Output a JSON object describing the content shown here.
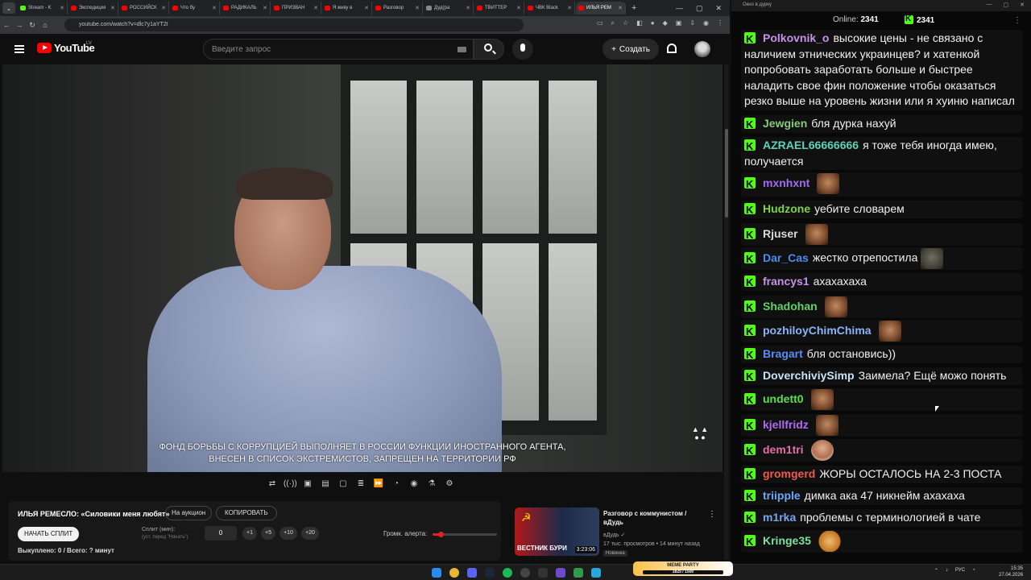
{
  "browser": {
    "tabs": [
      {
        "label": "Stream - K",
        "fav": "g"
      },
      {
        "label": "Экспедиция",
        "fav": "r"
      },
      {
        "label": "РОССИЙСК",
        "fav": "r"
      },
      {
        "label": "Что бу",
        "fav": "r"
      },
      {
        "label": "РАДИКАЛЬ",
        "fav": "r"
      },
      {
        "label": "ПРИЗВАН",
        "fav": "r"
      },
      {
        "label": "Я живу в",
        "fav": "r"
      },
      {
        "label": "Разговор",
        "fav": "r"
      },
      {
        "label": "Дуд(ра",
        "fav": "w"
      },
      {
        "label": "ТВИТТЕР",
        "fav": "r"
      },
      {
        "label": "ЧВК Black",
        "fav": "r"
      },
      {
        "label": "ИЛЬЯ РЕМ",
        "fav": "r",
        "active": true
      }
    ],
    "url": "youtube.com/watch?v=dlc7y1aYT2I"
  },
  "youtube": {
    "logo_text": "YouTube",
    "country": "LV",
    "search_placeholder": "Введите запрос",
    "create_label": "Создать"
  },
  "video": {
    "subtitle_line1": "ФОНД БОРЬБЫ С КОРРУПЦИЕЙ ВЫПОЛНЯЕТ В РОССИИ ФУНКЦИИ ИНОСТРАННОГО АГЕНТА,",
    "subtitle_line2": "ВНЕСЕН В СПИСОК ЭКСТРЕМИСТОВ, ЗАПРЕЩЕН НА ТЕРРИТОРИИ РФ"
  },
  "toolbar": {
    "icons": [
      "loop-icon",
      "broadcast-icon",
      "screen-record-icon",
      "clapper-icon",
      "picture-in-picture-icon",
      "subtitles-icon",
      "speed-icon",
      "gauge-icon",
      "camera-icon",
      "lab-icon",
      "gear-icon"
    ],
    "glyphs": [
      "⇄",
      "((·))",
      "▣",
      "▤",
      "▢",
      "≣",
      "⏩",
      "◔",
      "◉",
      "⚗",
      "⚙"
    ]
  },
  "panel": {
    "title": "ИЛЬЯ РЕМЕСЛО: «Силовики меня любят»",
    "auction_label": "На аукцион",
    "copy_label": "КОПИРОВАТЬ",
    "split_button": "НАЧАТЬ СПЛИТ",
    "split_label": "Сплит (мин):",
    "split_hint": "(уст. перед \"Начать\")",
    "split_value": "0",
    "steps": [
      "+1",
      "+5",
      "+10",
      "+20"
    ],
    "alert_label": "Громк. алерта:",
    "alert_volume": 0.13,
    "bought": "Выкуплено: 0 / Всего: ? минут"
  },
  "recommendation": {
    "thumb_text": "ВЕСТНИК БУРИ",
    "duration": "3:23:06",
    "title": "Разговор с коммунистом / вДудь",
    "channel": "вДудь ✓",
    "meta": "17 тыс. просмотров • 14 минут назад",
    "badge": "Новинка"
  },
  "chat": {
    "window_title": "Окно в дурку",
    "online_label": "Online:",
    "online_count": "2341",
    "viewer_count": "2341",
    "messages": [
      {
        "user": "Polkovnik_o",
        "color": "#c792ea",
        "text": "высокие цены - не связано с наличием этнических украинцев? и хатенкой попробовать заработать больше и быстрее наладить свое фин положение чтобы оказаться резко выше на уровень жизни или я хуиню написал",
        "emote": ""
      },
      {
        "user": "Jewgien",
        "color": "#86c97a",
        "text": "бля дурка нахуй",
        "emote": ""
      },
      {
        "user": "AZRAEL66666666",
        "color": "#5fd3b8",
        "text": "я тоже тебя иногда имею, получается",
        "emote": ""
      },
      {
        "user": "mxnhxnt",
        "color": "#a06cf0",
        "text": "",
        "emote": "laugh-emote"
      },
      {
        "user": "Hudzone",
        "color": "#7fd34f",
        "text": "уебите словарем",
        "emote": ""
      },
      {
        "user": "Rjuser",
        "color": "#d9d9d9",
        "text": "",
        "emote": "laugh-emote"
      },
      {
        "user": "Dar_Cas",
        "color": "#4c8cf0",
        "text": "жестко отрепостила",
        "emote": "rock-emote"
      },
      {
        "user": "francys1",
        "color": "#c792ea",
        "text": "ахахахаха",
        "emote": ""
      },
      {
        "user": "Shadohan",
        "color": "#62d36a",
        "text": "",
        "emote": "laugh-emote"
      },
      {
        "user": "pozhiloyChimChima",
        "color": "#8ab4f8",
        "text": "",
        "emote": "laugh-emote"
      },
      {
        "user": "Bragart",
        "color": "#5b8cf5",
        "text": "бля остановись))",
        "emote": ""
      },
      {
        "user": "DoverchiviySimp",
        "color": "#c9e3f7",
        "text": "Заимела? Ещё можо понять",
        "emote": ""
      },
      {
        "user": "undett0",
        "color": "#5be04a",
        "text": "",
        "emote": "laugh-emote"
      },
      {
        "user": "kjellfridz",
        "color": "#b06cf0",
        "text": "",
        "emote": "laugh-emote"
      },
      {
        "user": "dem1tri",
        "color": "#e86ea8",
        "text": "",
        "emote": "man-emote"
      },
      {
        "user": "gromgerd",
        "color": "#f05a4a",
        "text": "ЖОРЫ ОСТАЛОСЬ НА 2-3 ПОСТА",
        "emote": ""
      },
      {
        "user": "triipple",
        "color": "#6aa8f8",
        "text": "димка ака 47 никнейм ахахаха",
        "emote": ""
      },
      {
        "user": "m1rka",
        "color": "#7aa6f0",
        "text": "проблемы с терминологией в чате",
        "emote": ""
      },
      {
        "user": "Kringe35",
        "color": "#7ee0a0",
        "text": "",
        "emote": "fox-emote"
      }
    ]
  },
  "taskbar": {
    "meme_title": "MEME PARTY",
    "meme_progress": "1825 / 1500",
    "lang": "РУС",
    "time": "15:35",
    "date": "27.04.2026"
  }
}
